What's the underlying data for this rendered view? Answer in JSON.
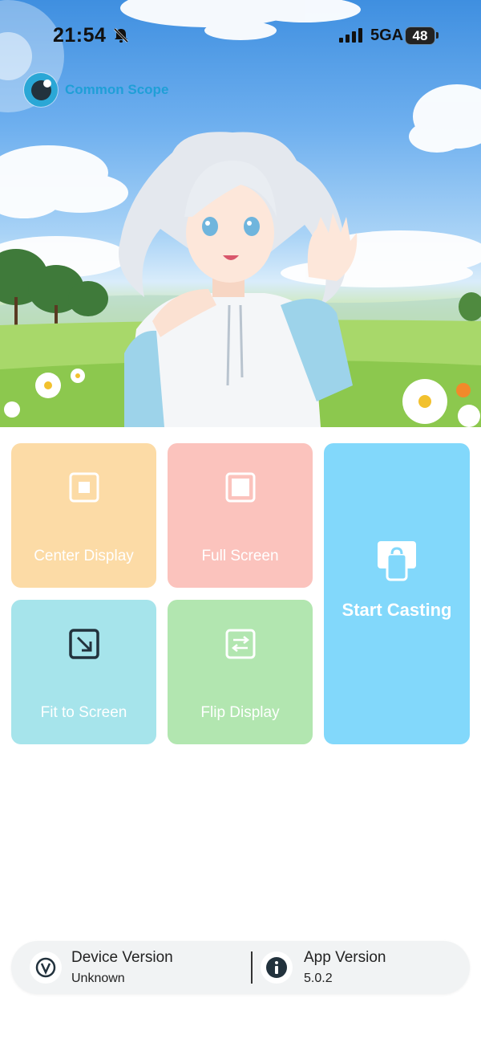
{
  "status_bar": {
    "time": "21:54",
    "network": "5GA",
    "battery": "48",
    "icons": [
      "bell-slash-icon",
      "signal-bars-icon",
      "battery-icon"
    ]
  },
  "brand": {
    "name": "Common Scope",
    "logo_icon": "eye-logo-icon",
    "color": "#1f9fd7"
  },
  "tiles": {
    "center_display": {
      "label": "Center Display",
      "icon": "center-square-icon",
      "color": "#fcdba6"
    },
    "full_screen": {
      "label": "Full Screen",
      "icon": "full-square-icon",
      "color": "#fbc3bd"
    },
    "fit_to_screen": {
      "label": "Fit to Screen",
      "icon": "fit-arrow-icon",
      "color": "#a6e4eb"
    },
    "flip_display": {
      "label": "Flip Display",
      "icon": "flip-arrows-icon",
      "color": "#b2e6b0"
    },
    "start_casting": {
      "label": "Start Casting",
      "icon": "cast-icon",
      "color": "#82d8fb"
    }
  },
  "footer": {
    "device": {
      "title": "Device Version",
      "value": "Unknown",
      "icon": "device-logo-icon"
    },
    "app": {
      "title": "App Version",
      "value": "5.0.2",
      "icon": "info-icon"
    }
  }
}
